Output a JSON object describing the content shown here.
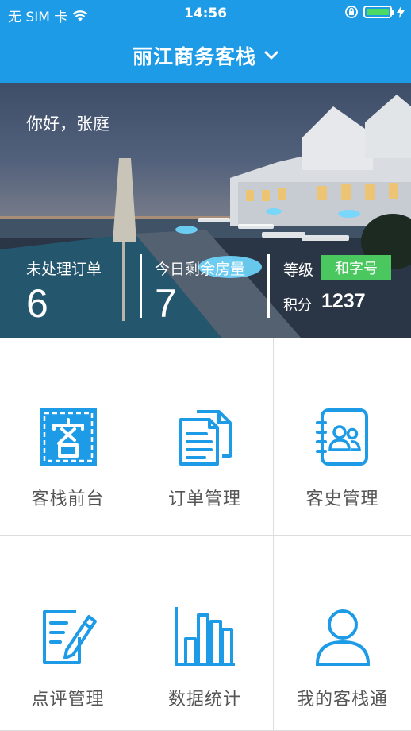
{
  "status_bar": {
    "carrier": "无 SIM 卡",
    "time": "14:56"
  },
  "header": {
    "title": "丽江商务客栈"
  },
  "hero": {
    "greeting": "你好，张庭",
    "pending_orders_label": "未处理订单",
    "pending_orders_value": "6",
    "rooms_left_label": "今日剩余房量",
    "rooms_left_value": "7",
    "level_label": "等级",
    "level_badge": "和字号",
    "points_label": "积分",
    "points_value": "1237"
  },
  "menu": [
    {
      "label": "客栈前台",
      "icon": "inn-front-desk-icon"
    },
    {
      "label": "订单管理",
      "icon": "documents-icon"
    },
    {
      "label": "客史管理",
      "icon": "contacts-book-icon"
    },
    {
      "label": "点评管理",
      "icon": "review-edit-icon"
    },
    {
      "label": "数据统计",
      "icon": "bar-chart-icon"
    },
    {
      "label": "我的客栈通",
      "icon": "user-icon"
    }
  ],
  "colors": {
    "header_bg": "#1e9be6",
    "icon_blue": "#1e9be6",
    "badge_green": "#4bc760",
    "battery_green": "#4cd964"
  }
}
